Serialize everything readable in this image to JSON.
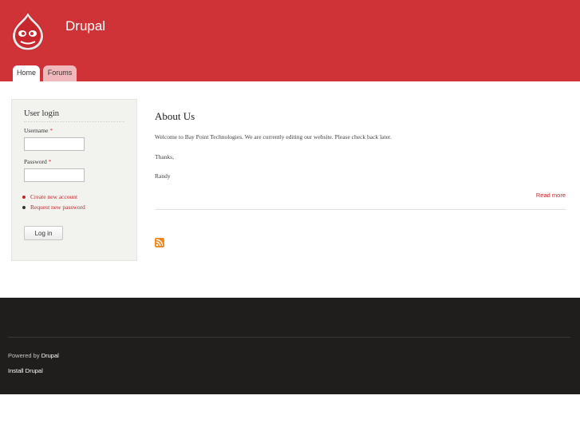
{
  "header": {
    "site_name": "Drupal",
    "logo_icon": "drupal-drop-icon",
    "bg_color": "#d03337",
    "tabs": [
      {
        "label": "Home",
        "active": true
      },
      {
        "label": "Forums",
        "active": false
      }
    ]
  },
  "sidebar": {
    "block_title": "User login",
    "username_label": "Username",
    "password_label": "Password",
    "required_marker": "*",
    "username_value": "",
    "password_value": "",
    "links": [
      "Create new account",
      "Request new password"
    ],
    "login_button": "Log in"
  },
  "main": {
    "title": "About Us",
    "paragraphs": [
      "Welcome to Bay Point Technologies. We are currently editing our website. Please check back later.",
      "Thanks,",
      "Randy"
    ],
    "read_more": "Read more",
    "feed_icon": "rss-feed-icon"
  },
  "footer": {
    "powered_prefix": "Powered by",
    "powered_link": "Drupal",
    "install_link": "Install Drupal",
    "bg_color": "#1f1e1d"
  },
  "colors": {
    "accent": "#d03337",
    "link": "#c0262b"
  }
}
